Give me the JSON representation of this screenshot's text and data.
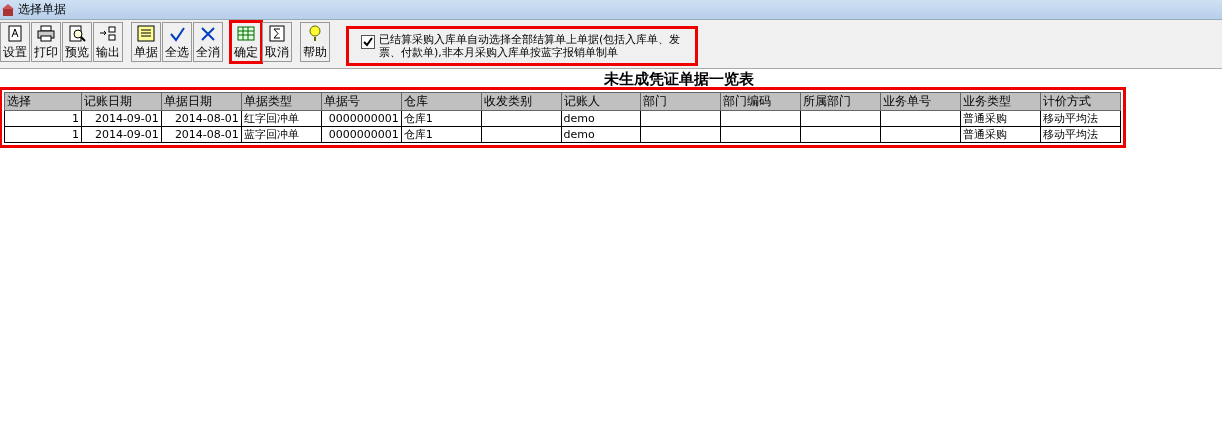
{
  "window": {
    "title": "选择单据"
  },
  "toolbar": {
    "groups": [
      [
        {
          "label": "设置",
          "annotated": false
        },
        {
          "label": "打印",
          "annotated": false
        },
        {
          "label": "预览",
          "annotated": false
        },
        {
          "label": "输出",
          "annotated": false
        }
      ],
      [
        {
          "label": "单据",
          "annotated": false
        },
        {
          "label": "全选",
          "annotated": false
        },
        {
          "label": "全消",
          "annotated": false
        }
      ],
      [
        {
          "label": "确定",
          "annotated": true
        },
        {
          "label": "取消",
          "annotated": false
        }
      ],
      [
        {
          "label": "帮助",
          "annotated": false
        }
      ]
    ]
  },
  "option": {
    "checked": true,
    "annotated": true,
    "label": "已结算采购入库单自动选择全部结算单上单据(包括入库单、发票、付款单),非本月采购入库单按蓝字报销单制单"
  },
  "table": {
    "title": "未生成凭证单据一览表",
    "annotated": true,
    "columns": [
      "选择",
      "记账日期",
      "单据日期",
      "单据类型",
      "单据号",
      "仓库",
      "收发类别",
      "记账人",
      "部门",
      "部门编码",
      "所属部门",
      "业务单号",
      "业务类型",
      "计价方式"
    ],
    "rows": [
      [
        "1",
        "2014-09-01",
        "2014-08-01",
        "红字回冲单",
        "0000000001",
        "仓库1",
        "",
        "demo",
        "",
        "",
        "",
        "",
        "普通采购",
        "移动平均法"
      ],
      [
        "1",
        "2014-09-01",
        "2014-08-01",
        "蓝字回冲单",
        "0000000001",
        "仓库1",
        "",
        "demo",
        "",
        "",
        "",
        "",
        "普通采购",
        "移动平均法"
      ]
    ]
  }
}
